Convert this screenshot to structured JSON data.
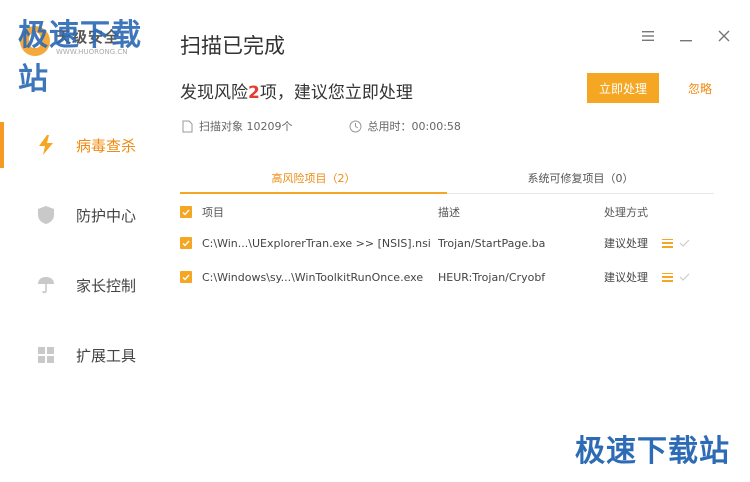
{
  "watermark": "极速下载站",
  "logo": {
    "name": "天级安全",
    "url": "WWW.HUORONG.CN"
  },
  "sidebar": {
    "items": [
      {
        "label": "病毒查杀",
        "icon": "lightning-icon",
        "active": true
      },
      {
        "label": "防护中心",
        "icon": "shield-icon",
        "active": false
      },
      {
        "label": "家长控制",
        "icon": "umbrella-icon",
        "active": false
      },
      {
        "label": "扩展工具",
        "icon": "grid-icon",
        "active": false
      }
    ]
  },
  "header": {
    "title": "扫描已完成",
    "risk_prefix": "发现风险",
    "risk_count": "2",
    "risk_suffix": "项，建议您立即处理",
    "handle_button": "立即处理",
    "ignore_link": "忽略"
  },
  "stats": {
    "scanned_label": "扫描对象 10209个",
    "time_label": "总用时：00:00:58"
  },
  "tabs": [
    {
      "label": "高风险项目（2）",
      "active": true
    },
    {
      "label": "系统可修复项目（0）",
      "active": false
    }
  ],
  "table": {
    "headers": {
      "item": "项目",
      "desc": "描述",
      "action": "处理方式"
    },
    "rows": [
      {
        "item": "C:\\Win...\\UExplorerTran.exe >> [NSIS].nsi",
        "desc": "Trojan/StartPage.ba",
        "action": "建议处理"
      },
      {
        "item": "C:\\Windows\\sy...\\WinToolkitRunOnce.exe",
        "desc": "HEUR:Trojan/Cryobf",
        "action": "建议处理"
      }
    ]
  },
  "colors": {
    "accent": "#f5a623",
    "risk": "#e53c2e",
    "watermark": "#2d6bb5"
  }
}
